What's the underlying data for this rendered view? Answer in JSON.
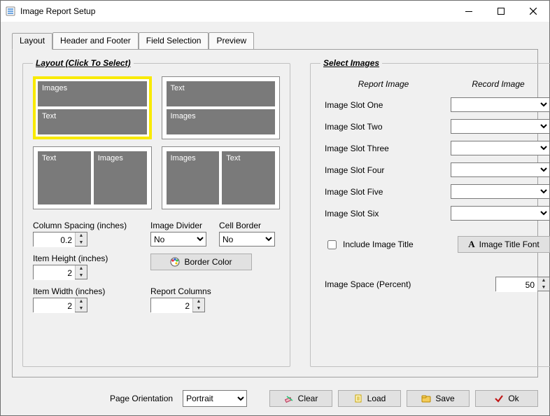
{
  "window": {
    "title": "Image Report Setup"
  },
  "tabs": [
    "Layout",
    "Header and Footer",
    "Field Selection",
    "Preview"
  ],
  "layout": {
    "legend": "Layout (Click To Select)",
    "tiles": {
      "t1": {
        "top": "Images",
        "bottom": "Text",
        "selected": true
      },
      "t2": {
        "top": "Text",
        "bottom": "Images"
      },
      "t3": {
        "left": "Text",
        "right": "Images"
      },
      "t4": {
        "left": "Images",
        "right": "Text"
      }
    },
    "column_spacing_label": "Column Spacing (inches)",
    "column_spacing": "0.2",
    "item_height_label": "Item Height (inches)",
    "item_height": "2",
    "item_width_label": "Item Width (inches)",
    "item_width": "2",
    "image_divider_label": "Image Divider",
    "image_divider": "No",
    "cell_border_label": "Cell Border",
    "cell_border": "No",
    "border_color_btn": "Border Color",
    "report_columns_label": "Report Columns",
    "report_columns": "2"
  },
  "select_images": {
    "legend": "Select Images",
    "col_report_image": "Report Image",
    "col_record_image": "Record Image",
    "slots": [
      {
        "label": "Image Slot One",
        "value": ""
      },
      {
        "label": "Image Slot Two",
        "value": ""
      },
      {
        "label": "Image Slot Three",
        "value": ""
      },
      {
        "label": "Image Slot Four",
        "value": ""
      },
      {
        "label": "Image Slot Five",
        "value": ""
      },
      {
        "label": "Image Slot Six",
        "value": ""
      }
    ],
    "include_image_title_label": "Include Image Title",
    "include_image_title": false,
    "image_title_font_btn": "Image Title Font",
    "image_space_label": "Image Space (Percent)",
    "image_space": "50"
  },
  "footer": {
    "page_orientation_label": "Page Orientation",
    "page_orientation": "Portrait",
    "clear": "Clear",
    "load": "Load",
    "save": "Save",
    "ok": "Ok"
  }
}
